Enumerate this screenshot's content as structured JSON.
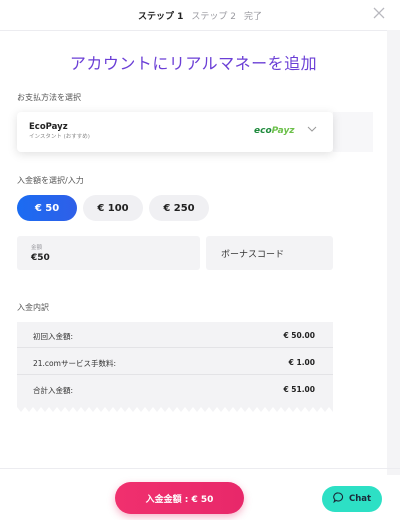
{
  "steps": [
    "ステップ 1",
    "ステップ 2",
    "完了"
  ],
  "close_icon": "close-icon",
  "title": "アカウントにリアルマネーを追加",
  "payment": {
    "label": "お支払方法を選択",
    "method_name": "EcoPayz",
    "method_sub": "インスタント (おすすめ)",
    "logo_part1": "eco",
    "logo_part2": "Payz"
  },
  "amount": {
    "label": "入金額を選択/入力",
    "chips": [
      "€ 50",
      "€ 100",
      "€ 250"
    ],
    "selected_index": 0,
    "input_caption": "金額",
    "input_value": "€50",
    "bonus_placeholder": "ボーナスコード"
  },
  "summary": {
    "label": "入金内訳",
    "rows": [
      {
        "label": "初回入金額:",
        "value": "€ 50.00"
      },
      {
        "label": "21.comサービス手数料:",
        "value": "€ 1.00"
      },
      {
        "label": "合計入金額:",
        "value": "€ 51.00"
      }
    ]
  },
  "footer": {
    "deposit_label": "入金金額 : € 50",
    "chat_label": "Chat"
  },
  "colors": {
    "accent_purple": "#6b3fd6",
    "selected_chip": "#1b6cf2",
    "deposit_pink": "#f0306e",
    "chat_teal": "#2de0c5"
  }
}
